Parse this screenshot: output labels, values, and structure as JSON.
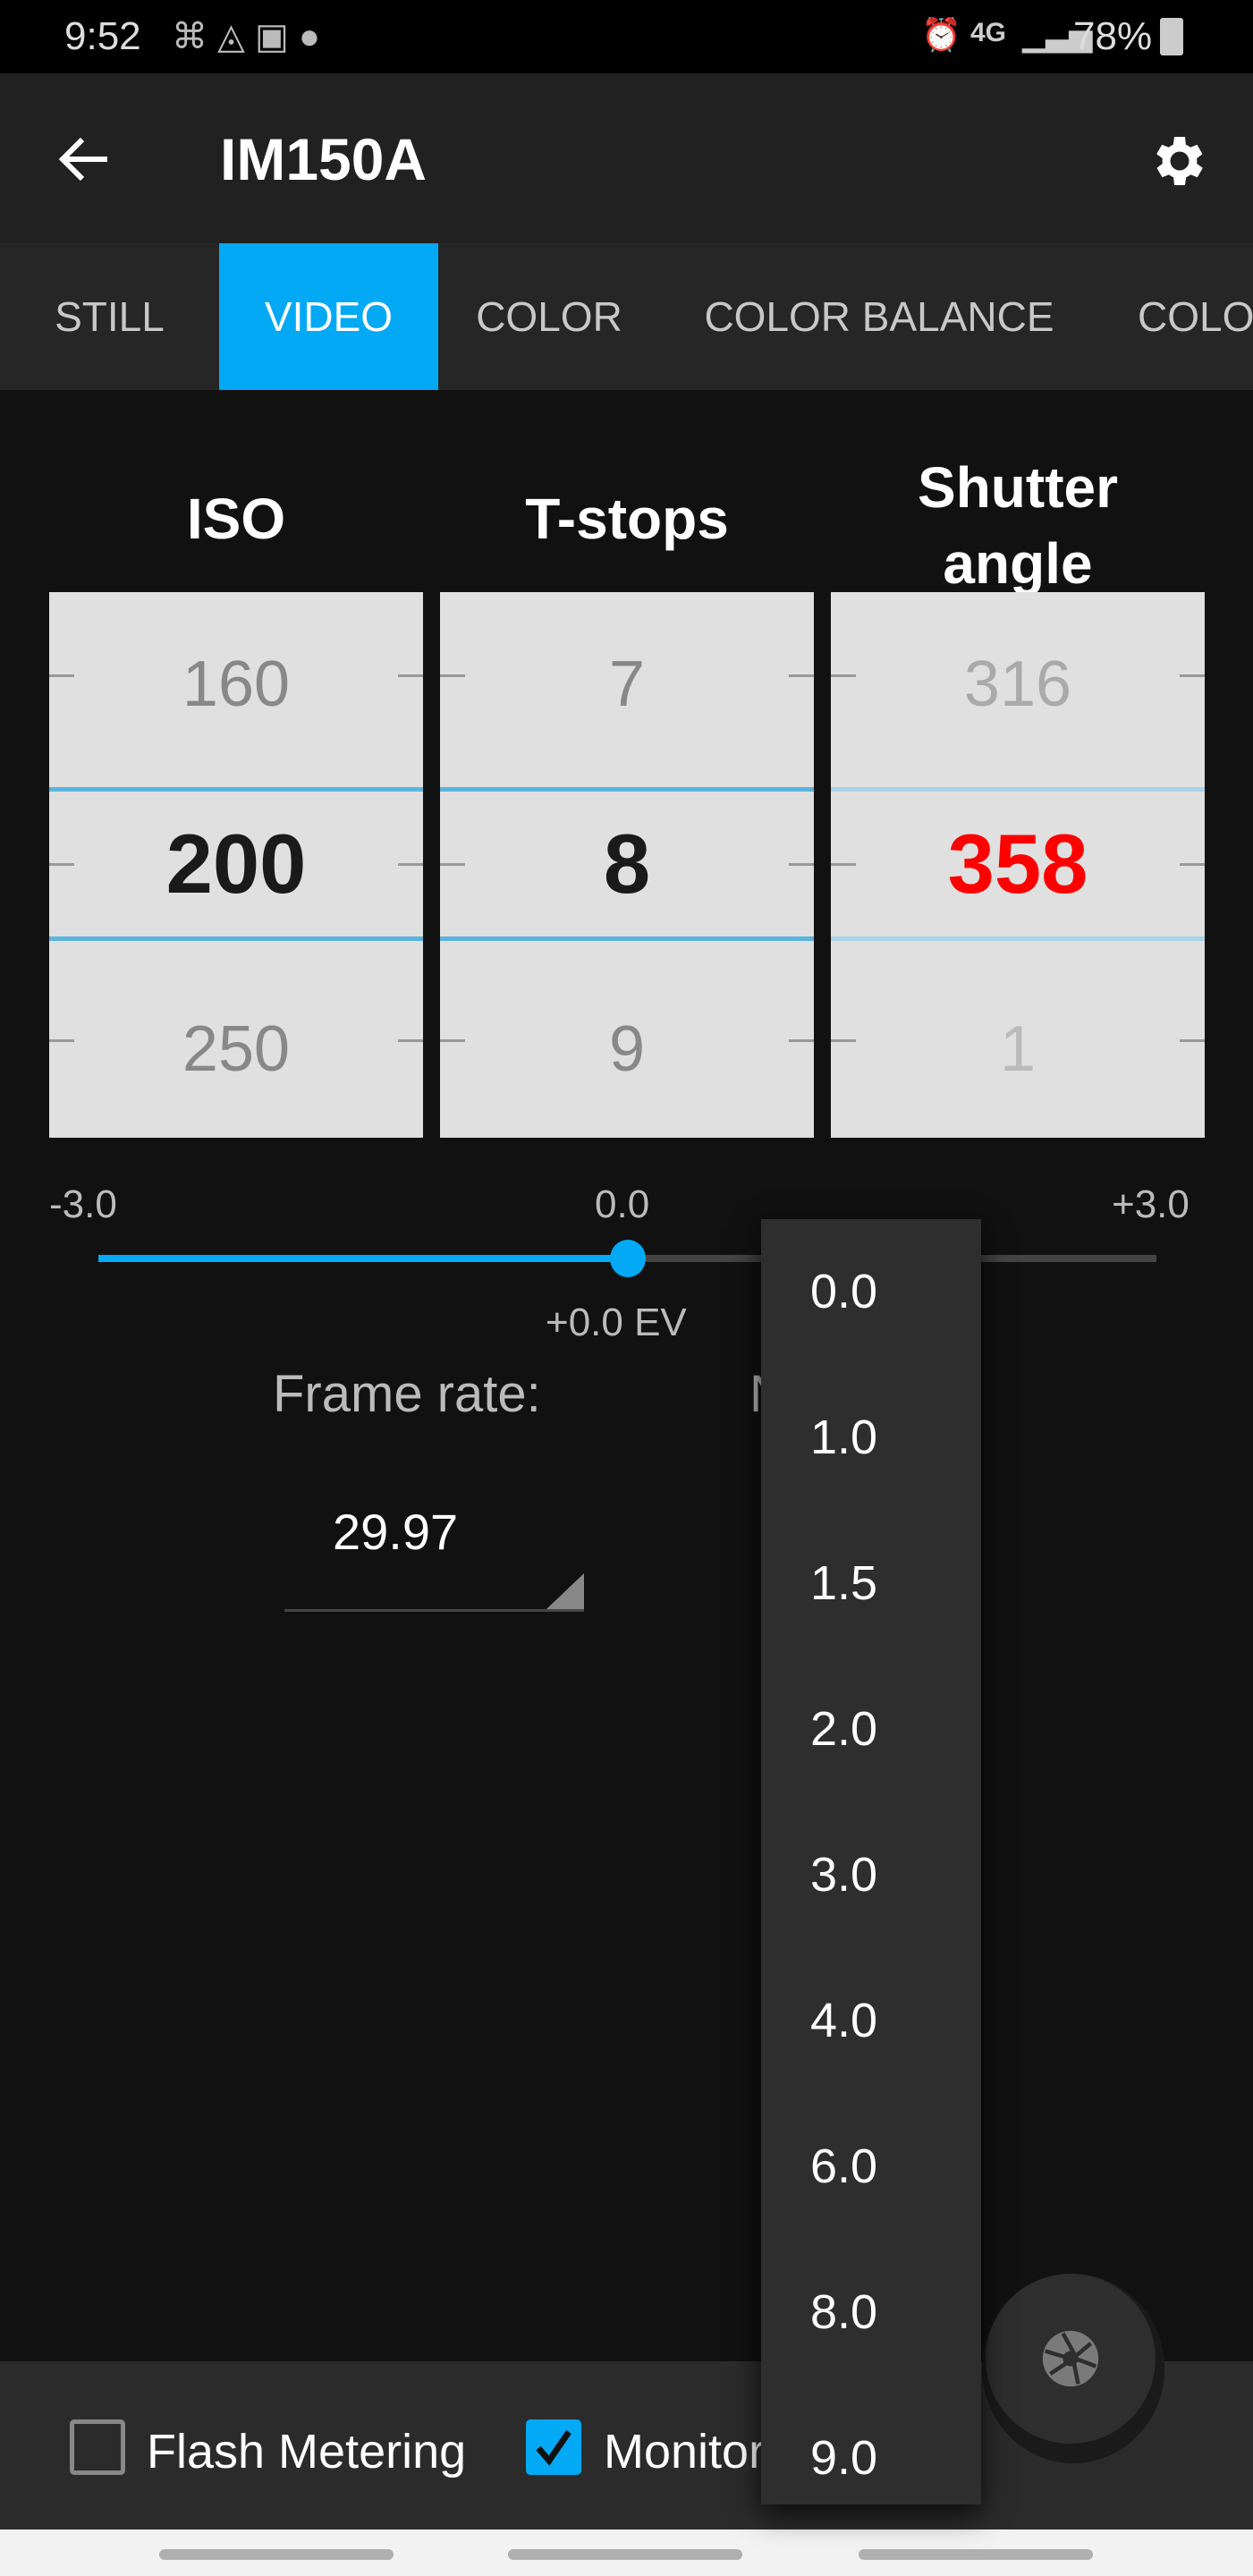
{
  "status_bar": {
    "time": "9:52",
    "battery": "78%",
    "network": "4G"
  },
  "app_bar": {
    "title": "IM150A",
    "back_icon": "arrow-left-icon",
    "settings_icon": "gear-icon"
  },
  "tabs": [
    {
      "label": "STILL"
    },
    {
      "label": "VIDEO",
      "active": true
    },
    {
      "label": "COLOR"
    },
    {
      "label": "COLOR BALANCE"
    },
    {
      "label": "COLO"
    }
  ],
  "colors": {
    "accent": "#03a9f4",
    "warning": "#ff0000"
  },
  "wheels": {
    "iso": {
      "header": "ISO",
      "prev": "160",
      "current": "200",
      "next": "250"
    },
    "tstops": {
      "header": "T-stops",
      "prev": "7",
      "current": "8",
      "next": "9"
    },
    "shutter": {
      "header_line1": "Shutter",
      "header_line2": "angle",
      "prev": "316",
      "current": "358",
      "next": "1"
    }
  },
  "ev_slider": {
    "min_label": "-3.0",
    "mid_label": "0.0",
    "max_label": "+3.0",
    "value": 0.0,
    "min": -3.0,
    "max": 3.0,
    "readout": "+0.0 EV"
  },
  "frame_rate": {
    "label": "Frame rate:",
    "value": "29.97"
  },
  "second_label_fragment": "N",
  "dropdown": {
    "options": [
      "0.0",
      "1.0",
      "1.5",
      "2.0",
      "3.0",
      "4.0",
      "6.0",
      "8.0",
      "9.0"
    ]
  },
  "bottom": {
    "flash_metering": {
      "label": "Flash Metering",
      "checked": false
    },
    "monitor": {
      "label": "Monitor",
      "checked": true
    }
  },
  "fab": {
    "icon": "shutter-aperture-icon"
  }
}
